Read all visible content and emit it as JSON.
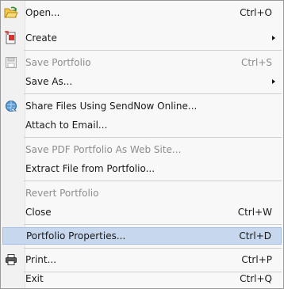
{
  "menu": {
    "items": [
      {
        "id": "open",
        "label": "Open...",
        "shortcut": "Ctrl+O",
        "icon": "open-folder-icon"
      },
      {
        "id": "create",
        "label": "Create",
        "submenu": true,
        "icon": "create-pdf-icon"
      },
      {
        "id": "save-portfolio",
        "label": "Save Portfolio",
        "shortcut": "Ctrl+S",
        "disabled": true,
        "icon": "save-disk-icon"
      },
      {
        "id": "save-as",
        "label": "Save As...",
        "submenu": true
      },
      {
        "id": "share-files",
        "label": "Share Files Using SendNow Online...",
        "icon": "share-online-icon"
      },
      {
        "id": "attach-email",
        "label": "Attach to Email..."
      },
      {
        "id": "save-web-site",
        "label": "Save PDF Portfolio As Web Site...",
        "disabled": true
      },
      {
        "id": "extract-file",
        "label": "Extract File from Portfolio..."
      },
      {
        "id": "revert",
        "label": "Revert Portfolio",
        "disabled": true
      },
      {
        "id": "close",
        "label": "Close",
        "shortcut": "Ctrl+W"
      },
      {
        "id": "properties",
        "label": "Portfolio Properties...",
        "shortcut": "Ctrl+D",
        "highlighted": true
      },
      {
        "id": "print",
        "label": "Print...",
        "shortcut": "Ctrl+P",
        "icon": "printer-icon"
      },
      {
        "id": "exit",
        "label": "Exit",
        "shortcut": "Ctrl+Q"
      }
    ]
  },
  "colors": {
    "highlight_bg": "#c6d7ee",
    "disabled_text": "#8d8d8d"
  }
}
